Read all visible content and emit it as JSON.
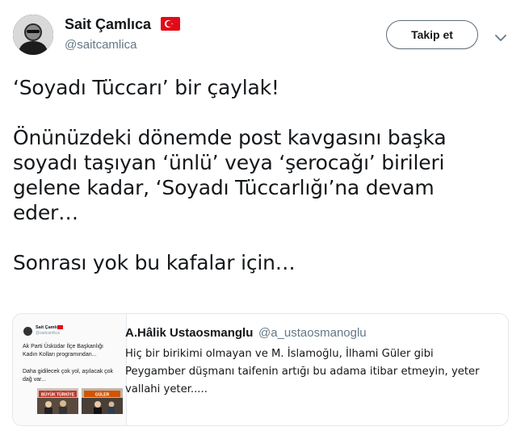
{
  "author": {
    "name": "Sait Çamlıca",
    "handle": "@saitcamlica",
    "flag_icon": "turkey-flag-icon"
  },
  "actions": {
    "follow_label": "Takip et",
    "more_icon": "chevron-down-icon"
  },
  "tweet": {
    "text": "‘Soyadı Tüccarı’ bir çaylak!\n\nÖnünüzdeki dönemde post kavgasını başka\nsoyadı taşıyan ‘ünlü’ veya ‘şerocağı’ birileri\ngelene kadar, ‘Soyadı Tüccarlığı’na devam\neder…\n\nSonrası yok bu kafalar için…"
  },
  "quoted_tweet": {
    "name": "A.Hâlik Ustaosmanglu",
    "handle": "@a_ustaosmanoglu",
    "text": "Hiç bir birikimi olmayan ve M. İslamoğlu, İlhami Güler gibi\nPeygamber düşmanı taifenin artığı bu adama itibar etmeyin, yeter\nvallahi yeter.....",
    "thumbnail": {
      "name": "Sait Çamlıca",
      "handle": "@saitcamlica",
      "text": "Ak Parti Üsküdar İlçe Başkanlığı Kadın Kolları programından...",
      "text2": "Daha gidilecek çok yol, aşılacak çok dağ var...",
      "banner_text_1": "BÜYÜK TÜRKİYE",
      "banner_text_2": "GÜLER"
    }
  },
  "colors": {
    "text_primary": "#14171a",
    "text_secondary": "#657786",
    "border": "#e1e8ed",
    "flag_red": "#e30a17"
  }
}
